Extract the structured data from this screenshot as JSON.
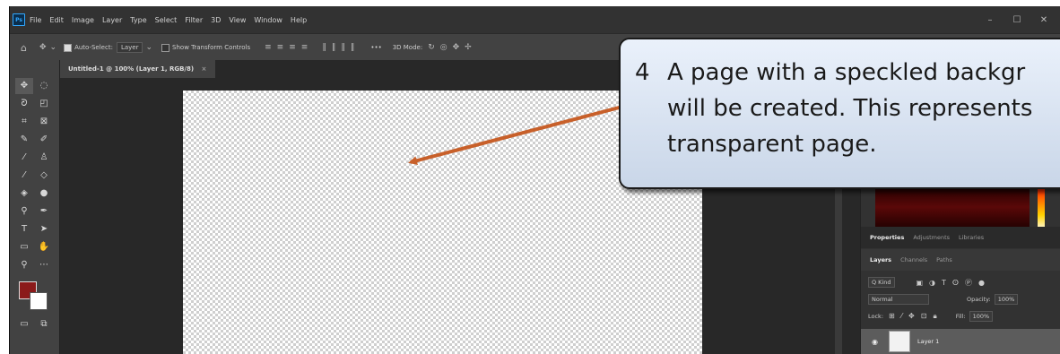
{
  "menubar": {
    "logo": "Ps",
    "items": [
      "File",
      "Edit",
      "Image",
      "Layer",
      "Type",
      "Select",
      "Filter",
      "3D",
      "View",
      "Window",
      "Help"
    ]
  },
  "options_bar": {
    "auto_select_label": "Auto-Select:",
    "layer_select": "Layer",
    "transform_label": "Show Transform Controls",
    "more": "•••",
    "mode_3d_label": "3D Mode:"
  },
  "document_tab": {
    "title": "Untitled-1 @ 100% (Layer 1, RGB/8)",
    "close": "×"
  },
  "panels": {
    "tabs_top": [
      "Properties",
      "Adjustments",
      "Libraries"
    ],
    "tabs_layers": [
      "Layers",
      "Channels",
      "Paths"
    ],
    "filter_kind": "Q Kind",
    "blend_mode": "Normal",
    "opacity_label": "Opacity:",
    "opacity_value": "100%",
    "lock_label": "Lock:",
    "fill_label": "Fill:",
    "fill_value": "100%",
    "layer_name": "Layer 1"
  },
  "callout": {
    "number": "4",
    "lines": [
      "A page with a speckled backgr",
      "will be created.  This represents",
      "transparent page."
    ]
  },
  "colors": {
    "foreground": "#8b1a1a",
    "background": "#ffffff",
    "arrow": "#c8602a",
    "callout_fill": "#dbe5f3"
  }
}
